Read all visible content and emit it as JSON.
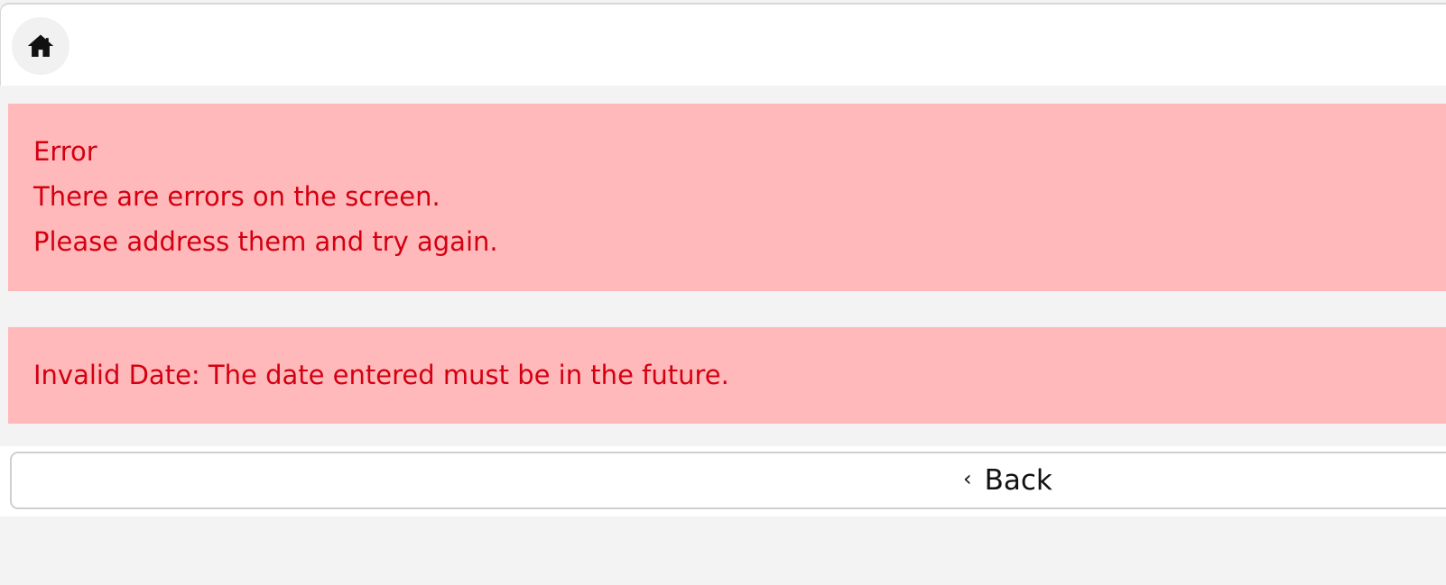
{
  "header": {
    "home_icon": "home-icon"
  },
  "alerts": {
    "summary": {
      "title": "Error",
      "line1": "There are errors on the screen.",
      "line2": "Please address them and try again."
    },
    "detail": {
      "message": "Invalid Date: The date entered must be in the future."
    }
  },
  "footer": {
    "back_label": "Back",
    "back_icon": "chevron-left-icon"
  },
  "colors": {
    "alert_background": "#ffb9ba",
    "alert_text": "#d40012",
    "page_background": "#f3f3f3"
  }
}
